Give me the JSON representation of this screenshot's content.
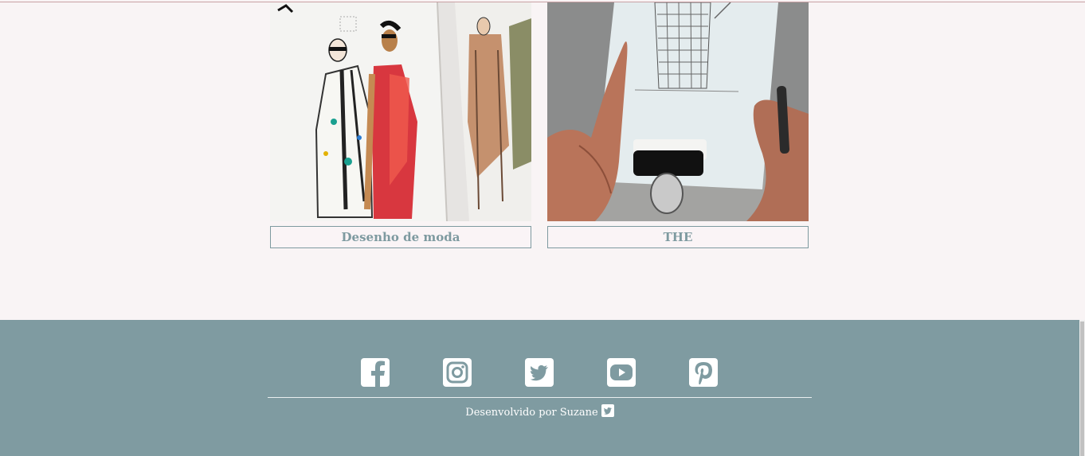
{
  "gallery": {
    "cards": [
      {
        "caption": "Desenho de moda",
        "image": "fashion-sketches-photo"
      },
      {
        "caption": "THE",
        "image": "architecture-sketch-photo"
      }
    ]
  },
  "footer": {
    "socials": [
      {
        "icon": "facebook-icon"
      },
      {
        "icon": "instagram-icon"
      },
      {
        "icon": "twitter-icon"
      },
      {
        "icon": "youtube-icon"
      },
      {
        "icon": "pinterest-icon"
      }
    ],
    "credit_text": "Desenvolvido por Suzane",
    "credit_icon": "twitter-icon"
  },
  "colors": {
    "background": "#f9f4f5",
    "footer": "#7f9ba1",
    "caption_text": "#7e9aa0",
    "icon": "#ffffff"
  }
}
